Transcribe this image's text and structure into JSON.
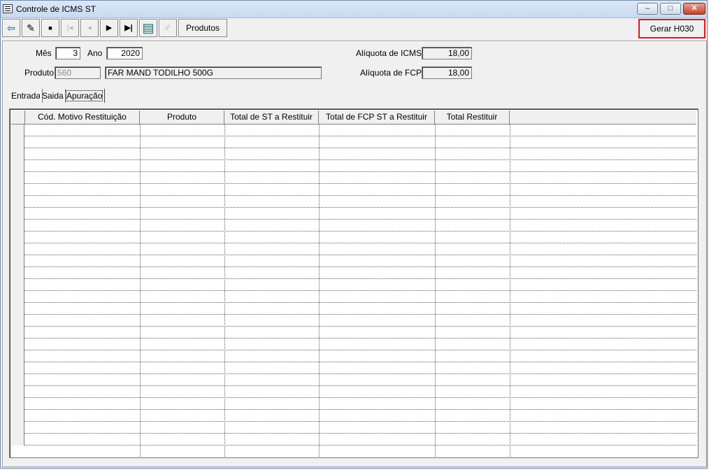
{
  "window": {
    "title": "Controle de ICMS ST",
    "controls": {
      "minimize": "–",
      "maximize": "□",
      "close": "✕"
    }
  },
  "toolbar": {
    "buttons": [
      {
        "name": "exit-icon",
        "glyph": "⇦",
        "enabled": true
      },
      {
        "name": "edit-icon",
        "glyph": "✎",
        "enabled": true
      },
      {
        "name": "save-icon",
        "glyph": "▪",
        "enabled": true
      },
      {
        "name": "first-record-icon",
        "glyph": "|◂",
        "enabled": false
      },
      {
        "name": "previous-record-icon",
        "glyph": "◂",
        "enabled": false
      },
      {
        "name": "next-record-icon",
        "glyph": "▶",
        "enabled": true
      },
      {
        "name": "last-record-icon",
        "glyph": "▶|",
        "enabled": true
      },
      {
        "name": "list-icon",
        "glyph": "▤",
        "enabled": true
      },
      {
        "name": "filter-icon",
        "glyph": "⁄⁄",
        "enabled": false
      }
    ],
    "produtos_label": "Produtos",
    "gerar_label": "Gerar H030"
  },
  "form": {
    "mes_label": "Mês",
    "mes_value": "3",
    "ano_label": "Ano",
    "ano_value": "2020",
    "produto_label": "Produto",
    "produto_code": "560",
    "produto_name": "FAR MAND TODILHO 500G",
    "aliquota_icms_label": "Alíquota de ICMS",
    "aliquota_icms_value": "18,00",
    "aliquota_fcp_label": "Alíquota de FCP",
    "aliquota_fcp_value": "18,00"
  },
  "tabs": [
    {
      "label": "Entrada",
      "active": false
    },
    {
      "label": "Saida",
      "active": false
    },
    {
      "label": "Apuração",
      "active": true
    }
  ],
  "grid": {
    "columns": [
      "",
      "Cód. Motivo Restituição",
      "Produto",
      "Total de ST a Restituir",
      "Total de FCP ST a Restituir",
      "Total Restituir",
      ""
    ],
    "rows": []
  }
}
